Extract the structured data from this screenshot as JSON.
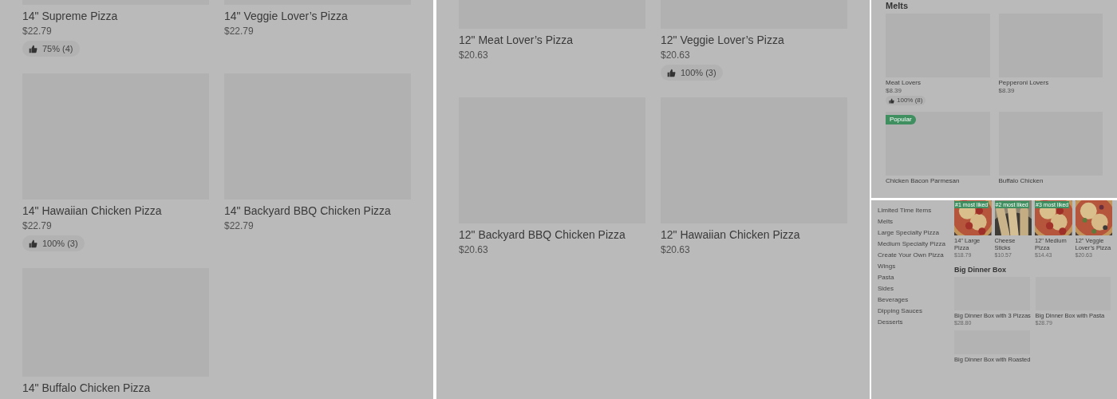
{
  "panels": [
    {
      "kind": "grid",
      "items": [
        {
          "name": "14\" Supreme Pizza",
          "price": "$22.79",
          "rating": "75% (4)"
        },
        {
          "name": "14\" Veggie Lover’s Pizza",
          "price": "$22.79"
        },
        {
          "name": "14\" Hawaiian Chicken Pizza",
          "price": "$22.79",
          "rating": "100% (3)"
        },
        {
          "name": "14\" Backyard BBQ Chicken Pizza",
          "price": "$22.79"
        },
        {
          "name": "14\" Buffalo Chicken Pizza"
        }
      ]
    },
    {
      "kind": "grid",
      "items": [
        {
          "name": "12\" Meat Lover’s Pizza",
          "price": "$20.63"
        },
        {
          "name": "12\" Veggie Lover’s Pizza",
          "price": "$20.63",
          "rating": "100% (3)"
        },
        {
          "name": "12\" Backyard BBQ Chicken Pizza",
          "price": "$20.63"
        },
        {
          "name": "12\" Hawaiian Chicken Pizza",
          "price": "$20.63"
        }
      ]
    },
    {
      "kind": "section",
      "heading": "Melts",
      "items": [
        {
          "name": "Meat Lovers",
          "price": "$8.39",
          "rating": "100% (8)"
        },
        {
          "name": "Pepperoni Lovers",
          "price": "$8.39"
        },
        {
          "name": "Chicken Bacon Parmesan",
          "badge": "Popular"
        },
        {
          "name": "Buffalo Chicken"
        }
      ]
    },
    {
      "kind": "menu",
      "sidebar": [
        "Limited Time Items",
        "Melts",
        "Large Specialty Pizza",
        "Medium Specialty Pizza",
        "Create Your Own Pizza",
        "Wings",
        "Pasta",
        "Sides",
        "Beverages",
        "Dipping Sauces",
        "Desserts"
      ],
      "popular": [
        {
          "badge": "#1 most liked",
          "name": "14\" Large Pizza",
          "price": "$18.79"
        },
        {
          "badge": "#2 most liked",
          "name": "Cheese Sticks",
          "price": "$10.57"
        },
        {
          "badge": "#3 most liked",
          "name": "12\" Medium Pizza",
          "price": "$14.43"
        },
        {
          "name": "12\" Veggie Lover’s Pizza",
          "price": "$20.63"
        }
      ],
      "heading": "Big Dinner Box",
      "items": [
        {
          "name": "Big Dinner Box with 3 Pizzas",
          "price": "$28.80"
        },
        {
          "name": "Big Dinner Box with Pasta",
          "price": "$28.79"
        },
        {
          "name": "Big Dinner Box with Roasted"
        }
      ]
    }
  ]
}
